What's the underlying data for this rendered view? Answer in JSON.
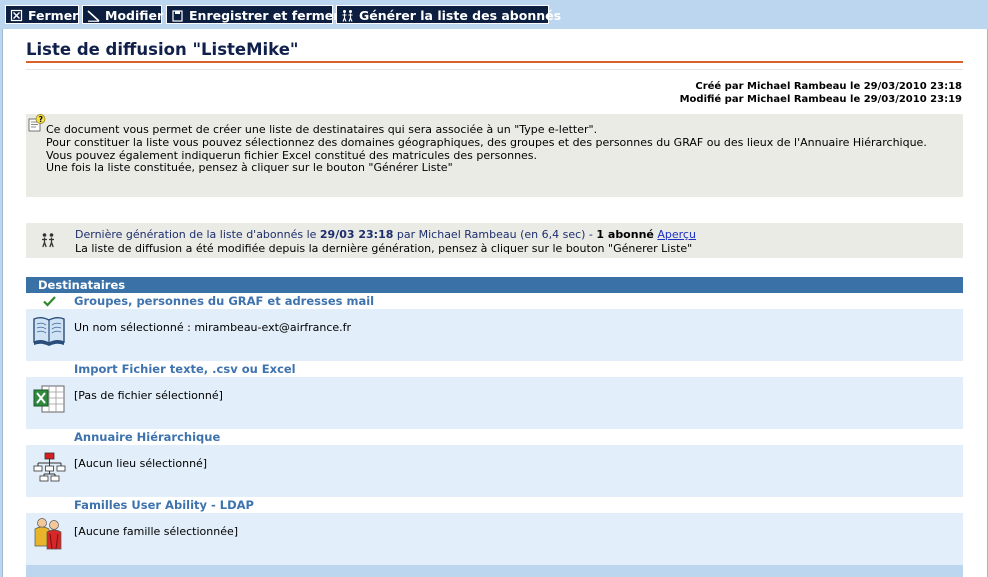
{
  "toolbar": {
    "close_label": "Fermer",
    "edit_label": "Modifier",
    "save_close_label": "Enregistrer et fermer",
    "generate_label": "Générer la liste des abonnés"
  },
  "page": {
    "title": "Liste de diffusion \"ListeMike\"",
    "created": "Créé par Michael Rambeau le 29/03/2010 23:18",
    "modified": "Modifié par Michael Rambeau le 29/03/2010 23:19"
  },
  "info": {
    "lines": [
      "Ce document vous permet de créer une liste de destinataires qui sera associée à un \"Type e-letter\".",
      "Pour constituer la liste vous pouvez sélectionnez des domaines géographiques, des groupes et des personnes du GRAF ou des lieux de l'Annuaire Hiérarchique.",
      "Vous pouvez également indiquerun fichier Excel constitué des matricules des personnes.",
      "Une fois la liste constituée, pensez à cliquer sur le bouton \"Générer Liste\""
    ]
  },
  "generation": {
    "prefix": "Dernière génération de la liste d'abonnés le ",
    "date": "29/03 23:18",
    "by": " par Michael Rambeau (en 6,4 sec) - ",
    "count": "1 abonné",
    "preview_link": "Aperçu",
    "notice": "La liste de diffusion a été modifiée depuis la dernière génération, pensez à cliquer sur le bouton \"Génerer Liste\""
  },
  "recipients": {
    "header": "Destinataires",
    "sections": [
      {
        "title": "Groupes, personnes du GRAF et adresses mail",
        "value": "Un nom sélectionné : mirambeau-ext@airfrance.fr",
        "icon": "book-icon"
      },
      {
        "title": "Import Fichier texte, .csv ou Excel",
        "value": "[Pas de fichier sélectionné]",
        "icon": "excel-icon"
      },
      {
        "title": "Annuaire Hiérarchique",
        "value": "[Aucun lieu sélectionné]",
        "icon": "org-chart-icon"
      },
      {
        "title": "Familles User Ability - LDAP",
        "value": "[Aucune famille sélectionnée]",
        "icon": "people-icon"
      }
    ]
  },
  "colors": {
    "toolbar_bg": "#0d1f40",
    "accent_rule": "#d9622a",
    "section_header": "#3a72a8",
    "section_title": "#3e73ae",
    "section_body": "#e2eef9"
  }
}
